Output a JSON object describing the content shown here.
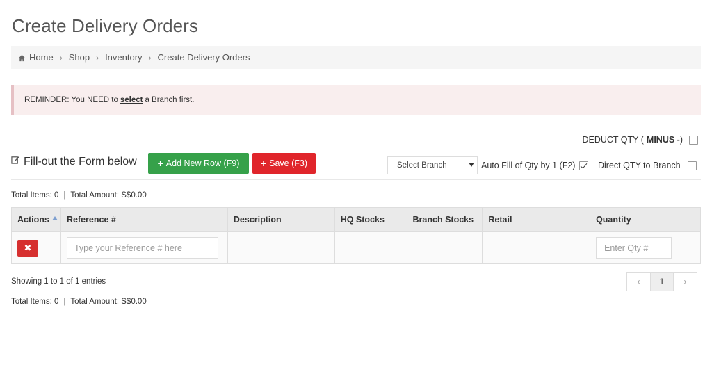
{
  "page_title": "Create Delivery Orders",
  "breadcrumb": [
    "Home",
    "Shop",
    "Inventory",
    "Create Delivery Orders"
  ],
  "reminder": {
    "prefix": "REMINDER: You NEED to",
    "emphasis": "select",
    "suffix": "a Branch first."
  },
  "deduct": {
    "label": "DEDUCT QTY (",
    "bold": "MINUS -",
    "close": ")",
    "checked": false
  },
  "form_title": "Fill-out the Form below",
  "buttons": {
    "add_row": "Add New Row (F9)",
    "save": "Save (F3)"
  },
  "branch_select": {
    "selected": "Select Branch"
  },
  "autofill": {
    "label": "Auto Fill of Qty by 1 (F2)",
    "checked": true
  },
  "direct_qty": {
    "label": "Direct QTY to Branch",
    "checked": false
  },
  "totals": {
    "items": "Total Items: 0",
    "separator": "|",
    "amount": "Total Amount: S$0.00"
  },
  "table": {
    "headers": [
      "Actions",
      "Reference #",
      "Description",
      "HQ Stocks",
      "Branch Stocks",
      "Retail",
      "Quantity"
    ],
    "row": {
      "reference_placeholder": "Type your Reference # here",
      "qty_placeholder": "Enter Qty #",
      "delete_label": "✖"
    }
  },
  "showing": "Showing 1 to 1 of 1 entries",
  "pagination": {
    "prev": "‹",
    "current": "1",
    "next": "›"
  },
  "colors": {
    "add": "#36a14a",
    "save": "#e0252b",
    "delete": "#d6302f",
    "reminder_bg": "#f9eeee"
  },
  "icons": {
    "home": "home-icon",
    "edit": "edit-icon",
    "sort": "sort-asc-icon"
  }
}
